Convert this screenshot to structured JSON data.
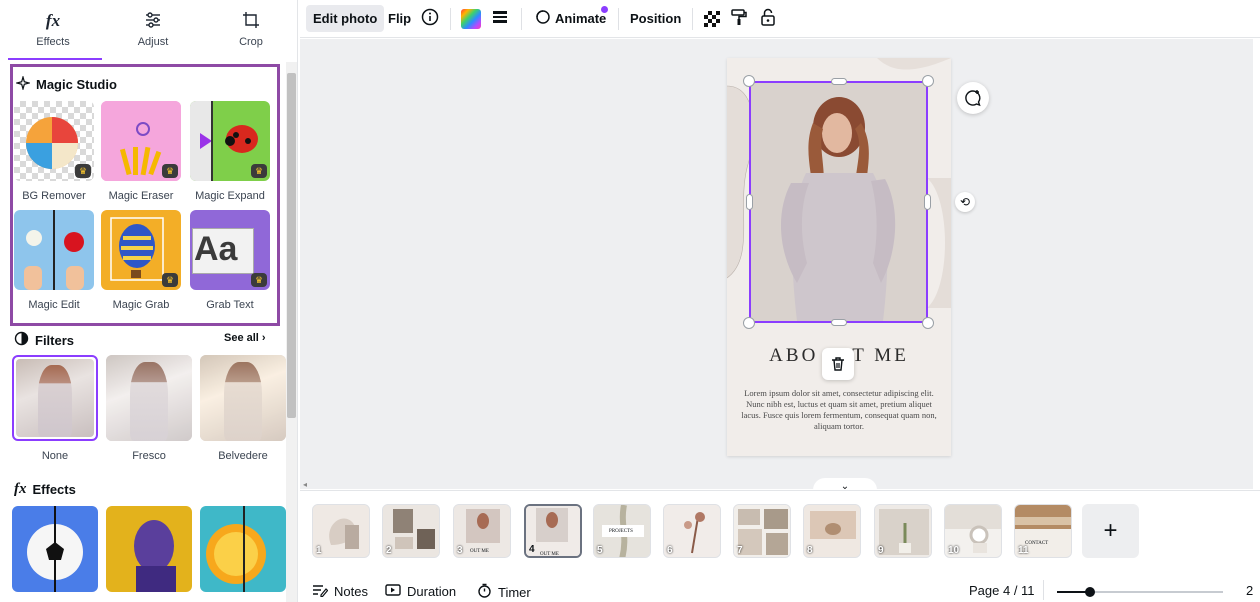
{
  "panel": {
    "tabs": [
      {
        "label": "Effects",
        "icon": "fx-icon"
      },
      {
        "label": "Adjust",
        "icon": "sliders-icon"
      },
      {
        "label": "Crop",
        "icon": "crop-icon"
      }
    ],
    "magic_studio": {
      "title": "Magic Studio",
      "tools": [
        {
          "label": "BG Remover",
          "premium": true
        },
        {
          "label": "Magic Eraser",
          "premium": true
        },
        {
          "label": "Magic Expand",
          "premium": true
        },
        {
          "label": "Magic Edit",
          "premium": false
        },
        {
          "label": "Magic Grab",
          "premium": true
        },
        {
          "label": "Grab Text",
          "premium": true
        }
      ]
    },
    "filters": {
      "title": "Filters",
      "see_all": "See all",
      "items": [
        {
          "label": "None",
          "selected": true
        },
        {
          "label": "Fresco",
          "selected": false
        },
        {
          "label": "Belvedere",
          "selected": false
        }
      ]
    },
    "effects": {
      "title": "Effects",
      "fx_glyph": "fx"
    },
    "tile_text_aa": "Aa"
  },
  "toolbar": {
    "edit_photo": "Edit photo",
    "flip": "Flip",
    "animate": "Animate",
    "position": "Position"
  },
  "canvas": {
    "page_title": "ABO",
    "page_title_tail": "T ME",
    "page_body": "Lorem ipsum dolor sit amet, consectetur adipiscing elit. Nunc nibh est, luctus et quam sit amet, pretium aliquet lacus. Fusce quis lorem fermentum, consequat quam non, aliquam tortor.",
    "selection_color": "#8b3dff"
  },
  "pages": {
    "thumbnails": [
      {
        "num": "1"
      },
      {
        "num": "2"
      },
      {
        "num": "3"
      },
      {
        "num": "4",
        "selected": true
      },
      {
        "num": "5"
      },
      {
        "num": "6"
      },
      {
        "num": "7"
      },
      {
        "num": "8"
      },
      {
        "num": "9"
      },
      {
        "num": "10"
      },
      {
        "num": "11"
      }
    ],
    "thumb_texts": {
      "t3": "OUT ME",
      "t4": "OUT ME",
      "t5": "PROJECTS",
      "t11": "CONTACT"
    },
    "add_label": "+"
  },
  "bottom": {
    "notes": "Notes",
    "duration": "Duration",
    "timer": "Timer",
    "page_indicator": "Page 4 / 11",
    "zoom_text": "2",
    "zoom_level": 0.2
  },
  "colors": {
    "accent": "#8b3dff",
    "magic_border": "#8e4aa5"
  }
}
